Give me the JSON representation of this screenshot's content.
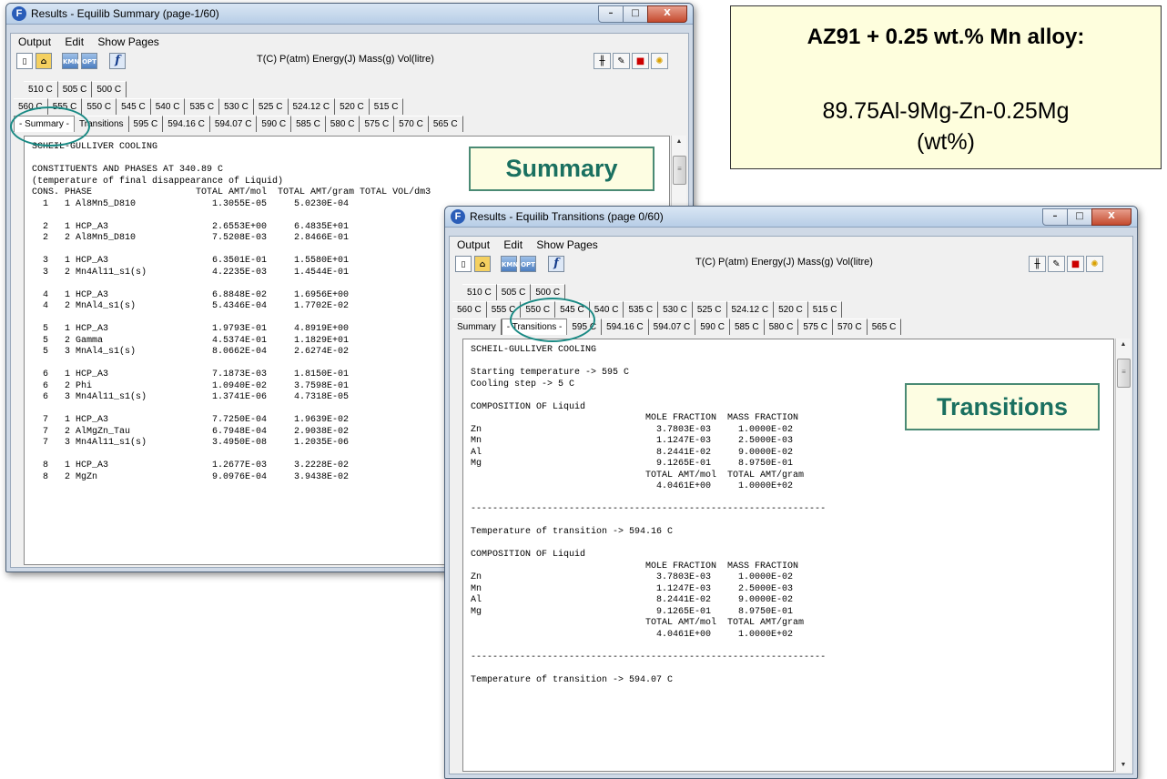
{
  "info_box": {
    "heading": "AZ91 + 0.25 wt.% Mn alloy:",
    "line1": "89.75Al-9Mg-Zn-0.25Mg",
    "line2": "(wt%)"
  },
  "summary_window": {
    "title": "Results - Equilib  Summary  (page-1/60)",
    "menu": [
      "Output",
      "Edit",
      "Show Pages"
    ],
    "toolbar_units": "T(C)  P(atm)  Energy(J)  Mass(g)  Vol(litre)",
    "tabs_row1": [
      "510 C",
      "505 C",
      "500 C"
    ],
    "tabs_row2": [
      "560 C",
      "555 C",
      "550 C",
      "545 C",
      "540 C",
      "535 C",
      "530 C",
      "525 C",
      "524.12 C",
      "520 C",
      "515 C"
    ],
    "tabs_row3": [
      "- Summary -",
      "Transitions",
      "595 C",
      "594.16 C",
      "594.07 C",
      "590 C",
      "585 C",
      "580 C",
      "575 C",
      "570 C",
      "565 C"
    ],
    "callout": "Summary",
    "content": "SCHEIL-GULLIVER COOLING\n\nCONSTITUENTS AND PHASES AT 340.89 C\n(temperature of final disappearance of Liquid)\nCONS. PHASE                   TOTAL AMT/mol  TOTAL AMT/gram TOTAL VOL/dm3\n  1   1 Al8Mn5_D810              1.3055E-05     5.0230E-04\n\n  2   1 HCP_A3                   2.6553E+00     6.4835E+01\n  2   2 Al8Mn5_D810              7.5208E-03     2.8466E-01\n\n  3   1 HCP_A3                   6.3501E-01     1.5580E+01\n  3   2 Mn4Al11_s1(s)            4.2235E-03     1.4544E-01\n\n  4   1 HCP_A3                   6.8848E-02     1.6956E+00\n  4   2 MnAl4_s1(s)              5.4346E-04     1.7702E-02\n\n  5   1 HCP_A3                   1.9793E-01     4.8919E+00\n  5   2 Gamma                    4.5374E-01     1.1829E+01\n  5   3 MnAl4_s1(s)              8.0662E-04     2.6274E-02\n\n  6   1 HCP_A3                   7.1873E-03     1.8150E-01\n  6   2 Phi                      1.0940E-02     3.7598E-01\n  6   3 Mn4Al11_s1(s)            1.3741E-06     4.7318E-05\n\n  7   1 HCP_A3                   7.7250E-04     1.9639E-02\n  7   2 AlMgZn_Tau               6.7948E-04     2.9038E-02\n  7   3 Mn4Al11_s1(s)            3.4950E-08     1.2035E-06\n\n  8   1 HCP_A3                   1.2677E-03     3.2228E-02\n  8   2 MgZn                     9.0976E-04     3.9438E-02"
  },
  "transitions_window": {
    "title": "Results - Equilib  Transitions  (page 0/60)",
    "menu": [
      "Output",
      "Edit",
      "Show Pages"
    ],
    "toolbar_units": "T(C)  P(atm)  Energy(J)  Mass(g)  Vol(litre)",
    "tabs_row1": [
      "510 C",
      "505 C",
      "500 C"
    ],
    "tabs_row2": [
      "560 C",
      "555 C",
      "550 C",
      "545 C",
      "540 C",
      "535 C",
      "530 C",
      "525 C",
      "524.12 C",
      "520 C",
      "515 C"
    ],
    "tabs_row3": [
      "Summary",
      "- Transitions -",
      "595 C",
      "594.16 C",
      "594.07 C",
      "590 C",
      "585 C",
      "580 C",
      "575 C",
      "570 C",
      "565 C"
    ],
    "callout": "Transitions",
    "content": "SCHEIL-GULLIVER COOLING\n\nStarting temperature -> 595 C\nCooling step -> 5 C\n\nCOMPOSITION OF Liquid\n                                MOLE FRACTION  MASS FRACTION\nZn                                3.7803E-03     1.0000E-02\nMn                                1.1247E-03     2.5000E-03\nAl                                8.2441E-02     9.0000E-02\nMg                                9.1265E-01     8.9750E-01\n                                TOTAL AMT/mol  TOTAL AMT/gram\n                                  4.0461E+00     1.0000E+02\n\n-----------------------------------------------------------------\n\nTemperature of transition -> 594.16 C\n\nCOMPOSITION OF Liquid\n                                MOLE FRACTION  MASS FRACTION\nZn                                3.7803E-03     1.0000E-02\nMn                                1.1247E-03     2.5000E-03\nAl                                8.2441E-02     9.0000E-02\nMg                                9.1265E-01     8.9750E-01\n                                TOTAL AMT/mol  TOTAL AMT/gram\n                                  4.0461E+00     1.0000E+02\n\n-----------------------------------------------------------------\n\nTemperature of transition -> 594.07 C"
  },
  "icons": {
    "new": "new-file-icon",
    "open": "open-folder-icon",
    "kmn": "KMN",
    "opt": "OPT",
    "func": "f",
    "right_tools": [
      "tools-icon",
      "edit-icon",
      "stop-icon",
      "bulb-icon"
    ]
  }
}
